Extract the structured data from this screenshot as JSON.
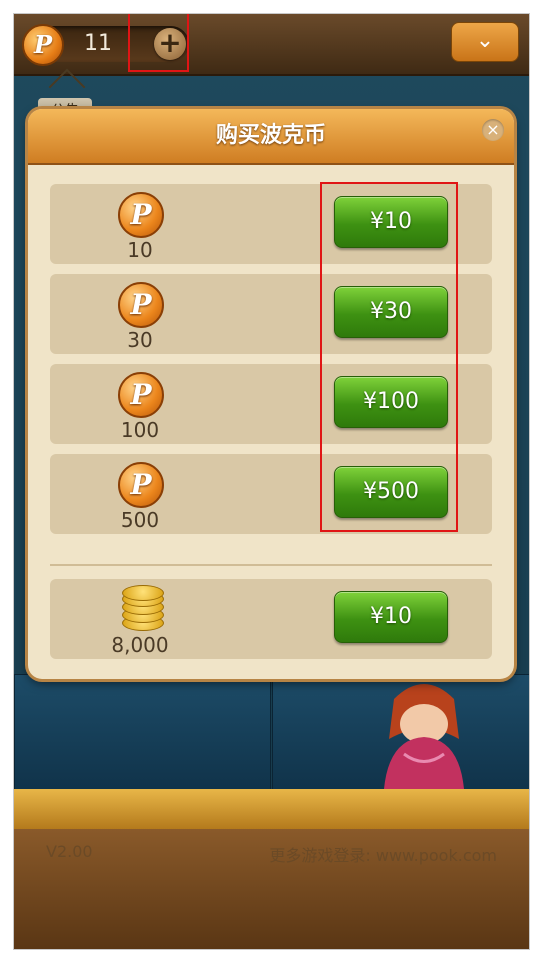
{
  "topbar": {
    "coin_symbol": "P",
    "coin_count": "11",
    "plus_label": "+",
    "menu_label": "⌄"
  },
  "notice_sign": "公告",
  "modal": {
    "title": "购买波克币",
    "close_label": "×",
    "packages": [
      {
        "coin_symbol": "P",
        "amount": "10",
        "price": "¥10"
      },
      {
        "coin_symbol": "P",
        "amount": "30",
        "price": "¥30"
      },
      {
        "coin_symbol": "P",
        "amount": "100",
        "price": "¥100"
      },
      {
        "coin_symbol": "P",
        "amount": "500",
        "price": "¥500"
      }
    ],
    "gold_package": {
      "amount": "8,000",
      "price": "¥10"
    }
  },
  "footer": {
    "version": "V2.00",
    "more_games": "更多游戏登录: www.pook.com"
  },
  "colors": {
    "accent_orange": "#cf7d22",
    "buy_green": "#3e9112",
    "highlight_red": "#e01515"
  }
}
